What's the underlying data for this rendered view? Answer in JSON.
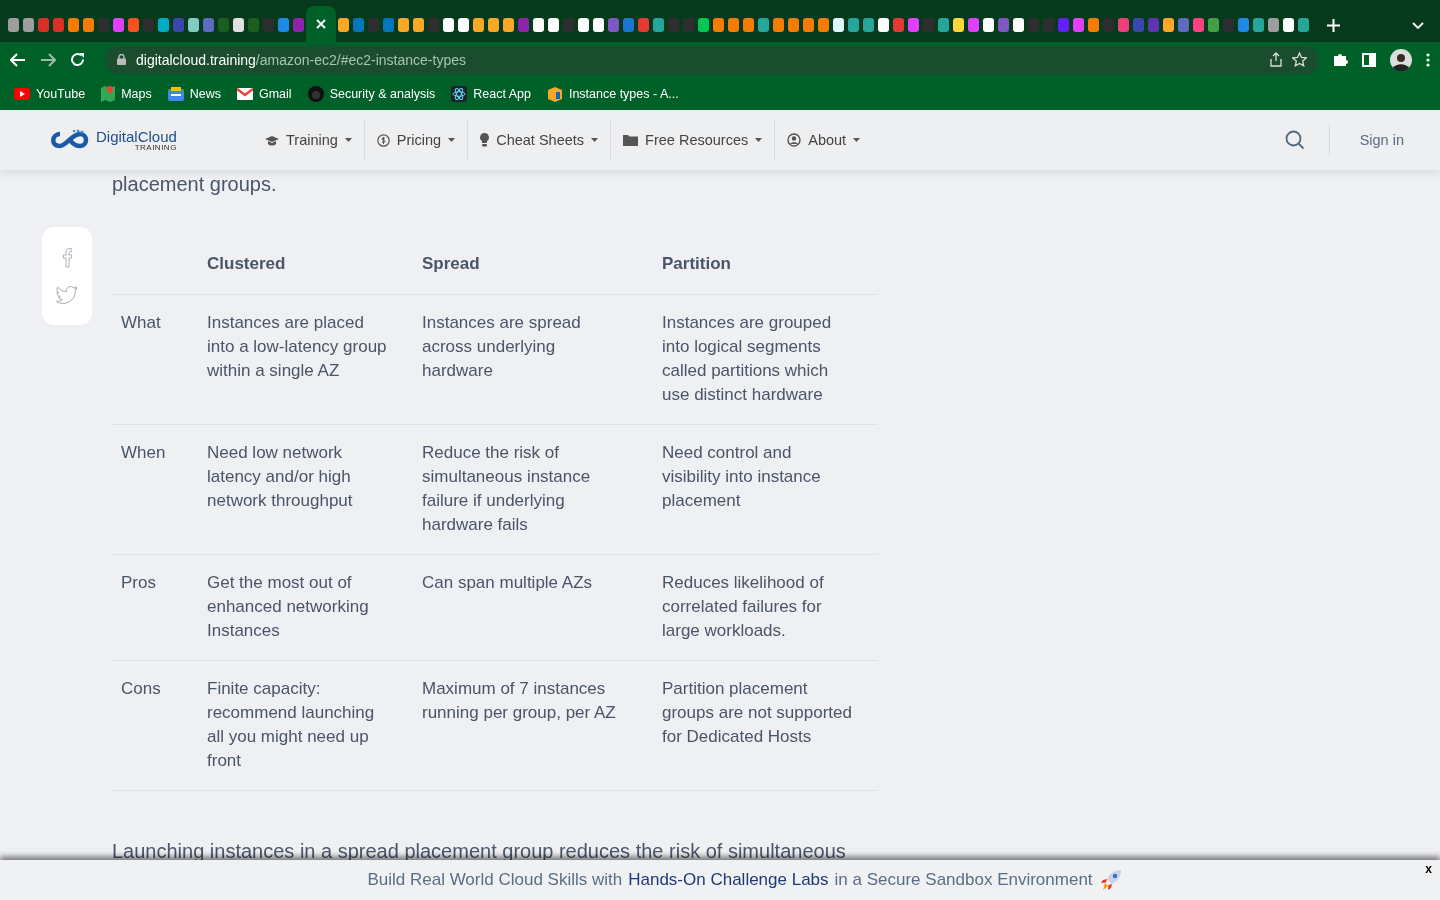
{
  "browser": {
    "tabs": [
      {
        "color": "#9e9e9e",
        "selected": false
      },
      {
        "color": "#9e9e9e",
        "selected": false
      },
      {
        "color": "#d93025",
        "selected": false
      },
      {
        "color": "#d93025",
        "selected": false
      },
      {
        "color": "#f57c00",
        "selected": false
      },
      {
        "color": "#f57c00",
        "selected": false
      },
      {
        "color": "#2e2e2e",
        "selected": false
      },
      {
        "color": "#e040fb",
        "selected": false
      },
      {
        "color": "#f4511e",
        "selected": false
      },
      {
        "color": "#2e2e2e",
        "selected": false
      },
      {
        "color": "#00acc1",
        "selected": false
      },
      {
        "color": "#3949ab",
        "selected": false
      },
      {
        "color": "#80cbc4",
        "selected": false
      },
      {
        "color": "#5c6bc0",
        "selected": false
      },
      {
        "color": "#1b5e20",
        "selected": false
      },
      {
        "color": "#e0e0e0",
        "selected": false
      },
      {
        "color": "#1b5e20",
        "selected": false
      },
      {
        "color": "#2e2e2e",
        "selected": false
      },
      {
        "color": "#1e88e5",
        "selected": false
      },
      {
        "color": "#8e24aa",
        "selected": false
      },
      {
        "color": "#ffffff",
        "selected": true
      },
      {
        "color": "#f9a825",
        "selected": false
      },
      {
        "color": "#0277bd",
        "selected": false
      },
      {
        "color": "#2e2e2e",
        "selected": false
      },
      {
        "color": "#0277bd",
        "selected": false
      },
      {
        "color": "#f9a825",
        "selected": false
      },
      {
        "color": "#f9a825",
        "selected": false
      },
      {
        "color": "#2e2e2e",
        "selected": false
      },
      {
        "color": "#ffffff",
        "selected": false
      },
      {
        "color": "#ffffff",
        "selected": false
      },
      {
        "color": "#f9a825",
        "selected": false
      },
      {
        "color": "#f9a825",
        "selected": false
      },
      {
        "color": "#f9a825",
        "selected": false
      },
      {
        "color": "#8e24aa",
        "selected": false
      },
      {
        "color": "#ffffff",
        "selected": false
      },
      {
        "color": "#ffffff",
        "selected": false
      },
      {
        "color": "#2e2e2e",
        "selected": false
      },
      {
        "color": "#ffffff",
        "selected": false
      },
      {
        "color": "#ffffff",
        "selected": false
      },
      {
        "color": "#7e57c2",
        "selected": false
      },
      {
        "color": "#1976d2",
        "selected": false
      },
      {
        "color": "#e53935",
        "selected": false
      },
      {
        "color": "#26a69a",
        "selected": false
      },
      {
        "color": "#2e2e2e",
        "selected": false
      },
      {
        "color": "#2e2e2e",
        "selected": false
      },
      {
        "color": "#00c853",
        "selected": false
      },
      {
        "color": "#f57c00",
        "selected": false
      },
      {
        "color": "#f57c00",
        "selected": false
      },
      {
        "color": "#f57c00",
        "selected": false
      },
      {
        "color": "#26a69a",
        "selected": false
      },
      {
        "color": "#f57c00",
        "selected": false
      },
      {
        "color": "#f57c00",
        "selected": false
      },
      {
        "color": "#f57c00",
        "selected": false
      },
      {
        "color": "#f57c00",
        "selected": false
      },
      {
        "color": "#e0f7fa",
        "selected": false
      },
      {
        "color": "#26a69a",
        "selected": false
      },
      {
        "color": "#26a69a",
        "selected": false
      },
      {
        "color": "#ffffff",
        "selected": false
      },
      {
        "color": "#e53935",
        "selected": false
      },
      {
        "color": "#e040fb",
        "selected": false
      },
      {
        "color": "#2e2e2e",
        "selected": false
      },
      {
        "color": "#26a69a",
        "selected": false
      },
      {
        "color": "#fdd835",
        "selected": false
      },
      {
        "color": "#e040fb",
        "selected": false
      },
      {
        "color": "#ffffff",
        "selected": false
      },
      {
        "color": "#7e57c2",
        "selected": false
      },
      {
        "color": "#ffffff",
        "selected": false
      },
      {
        "color": "#2e2e2e",
        "selected": false
      },
      {
        "color": "#2e2e2e",
        "selected": false
      },
      {
        "color": "#651fff",
        "selected": false
      },
      {
        "color": "#e040fb",
        "selected": false
      },
      {
        "color": "#f57c00",
        "selected": false
      },
      {
        "color": "#2e2e2e",
        "selected": false
      },
      {
        "color": "#ec407a",
        "selected": false
      },
      {
        "color": "#3949ab",
        "selected": false
      },
      {
        "color": "#5e35b1",
        "selected": false
      },
      {
        "color": "#ffa726",
        "selected": false
      },
      {
        "color": "#5c6bc0",
        "selected": false
      },
      {
        "color": "#ff4081",
        "selected": false
      },
      {
        "color": "#43a047",
        "selected": false
      },
      {
        "color": "#2e2e2e",
        "selected": false
      },
      {
        "color": "#1e88e5",
        "selected": false
      },
      {
        "color": "#26a69a",
        "selected": false
      },
      {
        "color": "#9e9e9e",
        "selected": false
      },
      {
        "color": "#ffffff",
        "selected": false
      },
      {
        "color": "#26a69a",
        "selected": false
      }
    ],
    "url_host": "digitalcloud.training",
    "url_path": "/amazon-ec2/#ec2-instance-types",
    "bookmarks": [
      {
        "kind": "video",
        "label": "YouTube"
      },
      {
        "kind": "map",
        "label": "Maps"
      },
      {
        "kind": "news",
        "label": "News"
      },
      {
        "kind": "mail",
        "label": "Gmail"
      },
      {
        "kind": "octo",
        "label": "Security & analysis"
      },
      {
        "kind": "atom",
        "label": "React App"
      },
      {
        "kind": "box",
        "label": "Instance types - A..."
      }
    ]
  },
  "site": {
    "logo": "DigitalCloud",
    "logo_sub": "TRAINING",
    "nav": [
      {
        "kind": "cap",
        "label": "Training"
      },
      {
        "kind": "dollar",
        "label": "Pricing"
      },
      {
        "kind": "bulb",
        "label": "Cheat Sheets"
      },
      {
        "kind": "folder",
        "label": "Free Resources"
      },
      {
        "kind": "person",
        "label": "About"
      }
    ],
    "sign_in": "Sign in"
  },
  "article": {
    "intro_tail": "placement groups.",
    "table": {
      "columns": [
        "Clustered",
        "Spread",
        "Partition"
      ],
      "rows": [
        {
          "label": "What",
          "cells": [
            "Instances are placed into a low-latency group within a single AZ",
            "Instances are spread across underlying hardware",
            "Instances are grouped into logical segments called partitions which use distinct hardware"
          ]
        },
        {
          "label": "When",
          "cells": [
            "Need low network latency and/or high network throughput",
            "Reduce the risk of simultaneous instance failure if underlying hardware fails",
            "Need control and visibility into instance placement"
          ]
        },
        {
          "label": "Pros",
          "cells": [
            "Get the most out of enhanced networking Instances",
            "Can span multiple AZs",
            "Reduces likelihood of correlated failures for large workloads."
          ]
        },
        {
          "label": "Cons",
          "cells": [
            "Finite capacity: recommend launching all you might need up front",
            "Maximum of 7 instances running per group, per AZ",
            "Partition placement groups are not supported for Dedicated Hosts"
          ]
        }
      ]
    },
    "paragraph": "Launching instances in a spread placement group reduces the risk of simultaneous"
  },
  "banner": {
    "before": "Build Real World Cloud Skills with",
    "link": "Hands-On Challenge Labs",
    "after": "in a Secure Sandbox Environment",
    "close": "x"
  }
}
